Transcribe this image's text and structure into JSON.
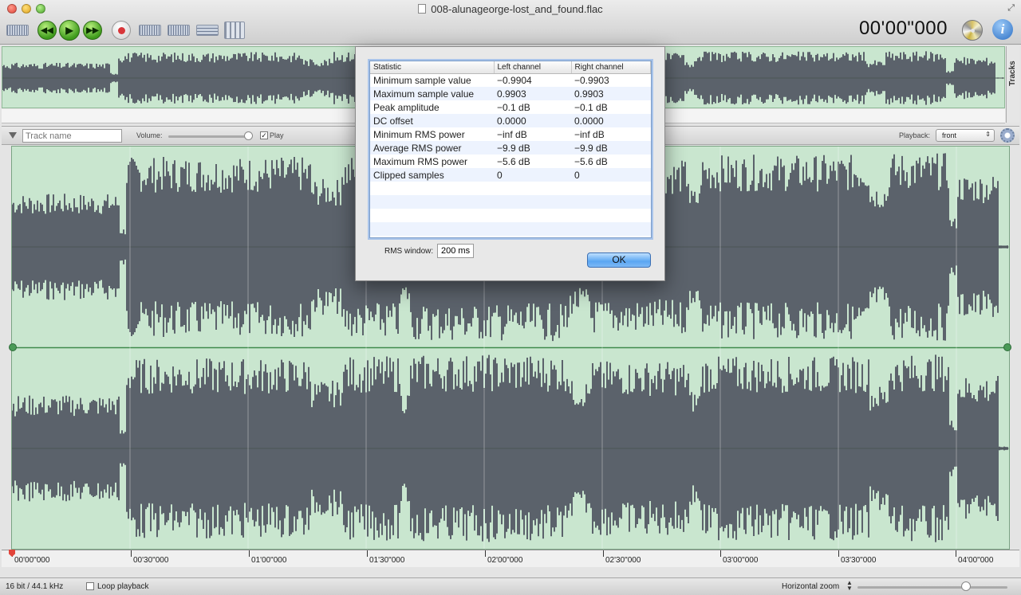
{
  "window": {
    "title": "008-alunageorge-lost_and_found.flac"
  },
  "toolbar": {
    "time_display": "00'00\"000",
    "buttons": [
      "input-level-icon",
      "rewind-icon",
      "play-icon",
      "fast-forward-icon",
      "record-icon",
      "loop-icon",
      "clear-icon",
      "effects-icon",
      "mixer-icon"
    ]
  },
  "overview": {
    "tracks_tab": "Tracks"
  },
  "track": {
    "name_placeholder": "Track name",
    "volume_label": "Volume:",
    "volume_level": 0.9,
    "play_label": "Play",
    "play_checked": true,
    "playback_label": "Playback:",
    "playback_value": "front"
  },
  "ruler": {
    "labels": [
      "00'00\"000",
      "00'30\"000",
      "01'00\"000",
      "01'30\"000",
      "02'00\"000",
      "02'30\"000",
      "03'00\"000",
      "03'30\"000",
      "04'00\"000"
    ]
  },
  "status": {
    "format": "16 bit / 44.1 kHz",
    "loop_label": "Loop playback",
    "zoom_label": "Horizontal zoom"
  },
  "dialog": {
    "headers": [
      "Statistic",
      "Left channel",
      "Right channel"
    ],
    "rows": [
      [
        "Minimum sample value",
        "−0.9904",
        "−0.9903"
      ],
      [
        "Maximum sample value",
        "0.9903",
        "0.9903"
      ],
      [
        "Peak amplitude",
        "−0.1 dB",
        "−0.1 dB"
      ],
      [
        "DC offset",
        "0.0000",
        "0.0000"
      ],
      [
        "Minimum RMS power",
        "−inf dB",
        "−inf dB"
      ],
      [
        "Average RMS power",
        "−9.9 dB",
        "−9.9 dB"
      ],
      [
        "Maximum RMS power",
        "−5.6 dB",
        "−5.6 dB"
      ],
      [
        "Clipped samples",
        "0",
        "0"
      ]
    ],
    "rms_label": "RMS window:",
    "rms_value": "200 ms",
    "ok_label": "OK"
  },
  "colors": {
    "wave_bg": "#c9e6cf",
    "wave_fill": "#5b626b",
    "accent": "#5aa6f2"
  }
}
